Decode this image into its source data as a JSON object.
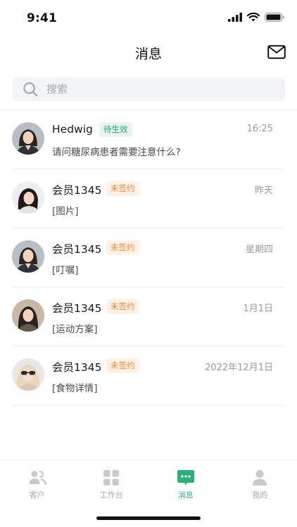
{
  "status_bar": {
    "time": "9:41"
  },
  "nav": {
    "title": "消息",
    "mail_icon": "mail-icon"
  },
  "search": {
    "placeholder": "搜索",
    "icon": "search-icon"
  },
  "messages": [
    {
      "name": "Hedwig",
      "badge": "待生效",
      "badge_color": "#27a36a",
      "preview": "请问糖尿病患者需要注意什么?",
      "time": "16:25"
    },
    {
      "name": "会员1345",
      "badge": "未签约",
      "badge_color": "#f0873a",
      "preview": "[图片]",
      "time": "昨天"
    },
    {
      "name": "会员1345",
      "badge": "未签约",
      "badge_color": "#f0873a",
      "preview": "[叮嘱]",
      "time": "星期四"
    },
    {
      "name": "会员1345",
      "badge": "未签约",
      "badge_color": "#f0873a",
      "preview": "[运动方案]",
      "time": "1月1日"
    },
    {
      "name": "会员1345",
      "badge": "未签约",
      "badge_color": "#f0873a",
      "preview": "[食物详情]",
      "time": "2022年12月1日"
    }
  ],
  "tabbar": {
    "items": [
      {
        "label": "客户",
        "icon": "customers-icon",
        "active": false
      },
      {
        "label": "工作台",
        "icon": "workbench-icon",
        "active": false
      },
      {
        "label": "消息",
        "icon": "message-icon",
        "active": true
      },
      {
        "label": "我的",
        "icon": "profile-icon",
        "active": false
      }
    ]
  },
  "colors": {
    "accent": "#2bb07a",
    "badge_green_bg": "#e6f6ee",
    "badge_orange_bg": "#fff1e6",
    "search_bg": "#f3f4f7"
  }
}
